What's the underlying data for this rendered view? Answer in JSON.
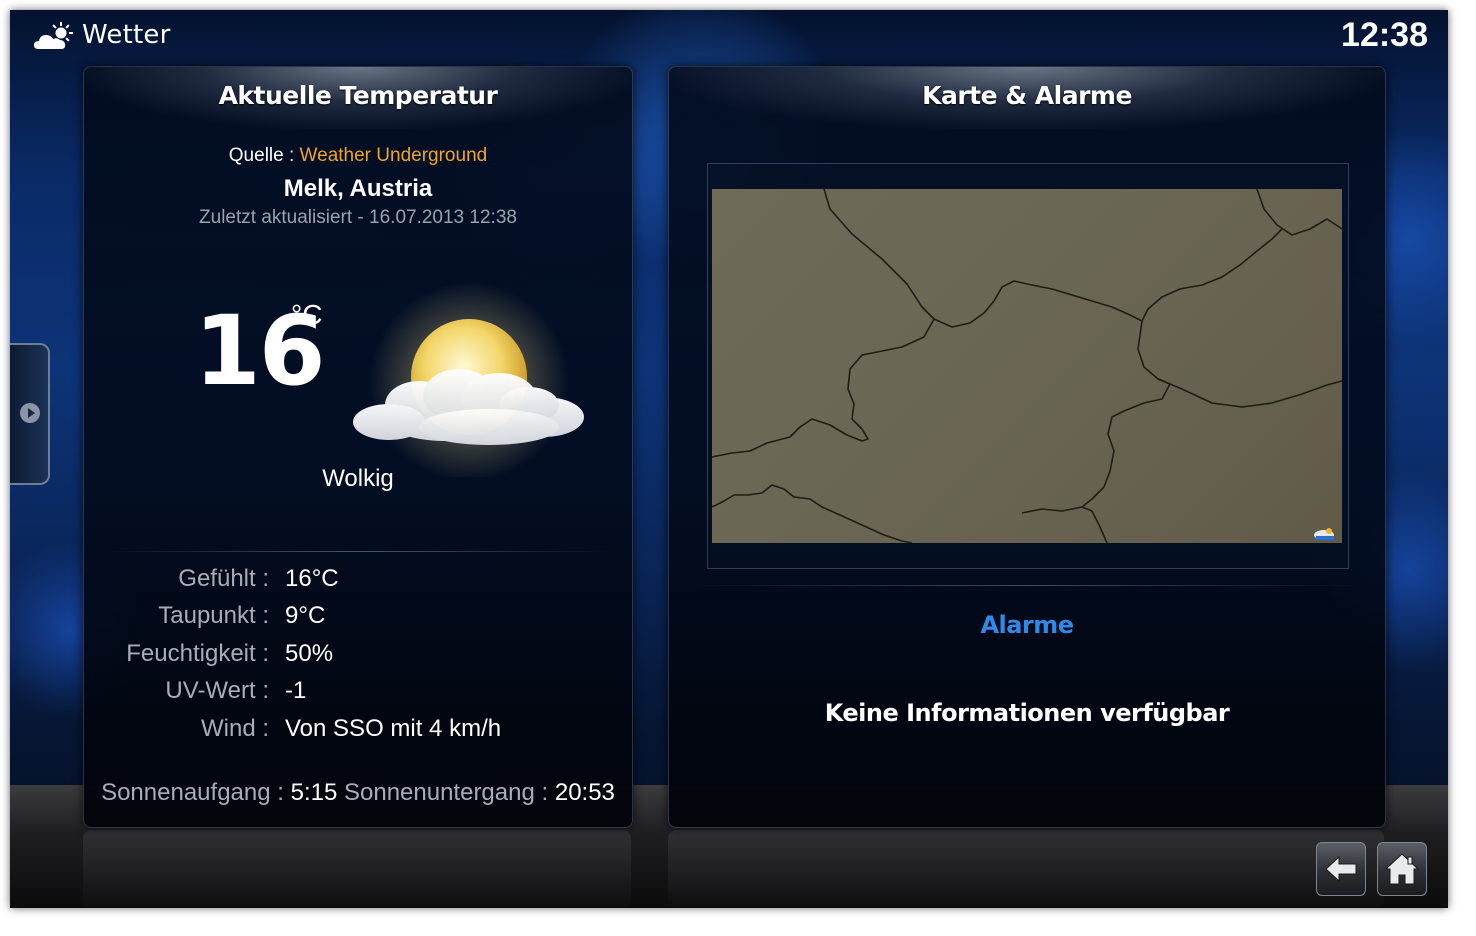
{
  "header": {
    "title": "Wetter",
    "icon": "weather-cloud-sun-icon",
    "clock": "12:38"
  },
  "current": {
    "panel_title": "Aktuelle Temperatur",
    "source_label": "Quelle :",
    "source_name": "Weather Underground",
    "location": "Melk, Austria",
    "updated": "Zuletzt aktualisiert - 16.07.2013 12:38",
    "temperature": "16",
    "temperature_unit": "°C",
    "condition": "Wolkig",
    "condition_icon": "partly-cloudy-icon",
    "details": [
      {
        "label": "Gefühlt :",
        "value": "16°C"
      },
      {
        "label": "Taupunkt :",
        "value": "9°C"
      },
      {
        "label": "Feuchtigkeit :",
        "value": "50%"
      },
      {
        "label": "UV-Wert :",
        "value": "-1"
      },
      {
        "label": "Wind :",
        "value": "Von SSO mit 4 km/h"
      }
    ],
    "sunrise_label": "Sonnenaufgang :",
    "sunrise": "5:15",
    "sunset_label": "Sonnenuntergang :",
    "sunset": "20:53"
  },
  "map_panel": {
    "panel_title": "Karte & Alarme",
    "alerts_heading": "Alarme",
    "alerts_message": "Keine Informationen verfügbar"
  },
  "nav": {
    "back_icon": "back-arrow-icon",
    "home_icon": "home-icon"
  },
  "colors": {
    "accent_source": "#f0a523",
    "alerts_heading": "#2f8ae6"
  }
}
